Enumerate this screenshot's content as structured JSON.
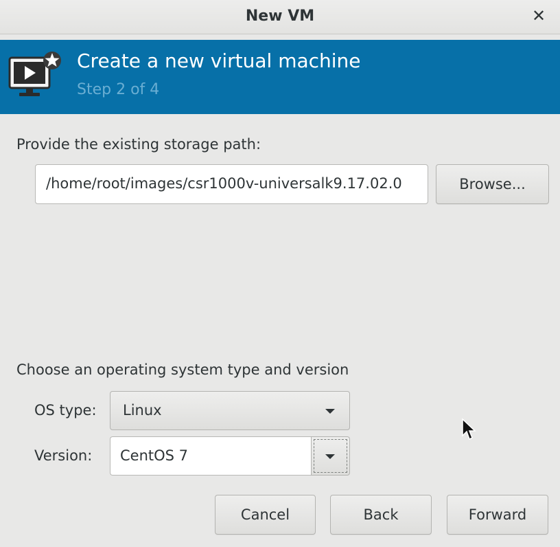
{
  "window": {
    "title": "New VM",
    "close_icon": "close-icon"
  },
  "banner": {
    "heading": "Create a new virtual machine",
    "step": "Step 2 of 4",
    "icon": "vm-screen-icon",
    "colors": {
      "background": "#0770a8",
      "step_text": "#6aaed3"
    }
  },
  "storage": {
    "label": "Provide the existing storage path:",
    "path_value": "/home/root/images/csr1000v-universalk9.17.02.0",
    "browse_label": "Browse..."
  },
  "os": {
    "heading": "Choose an operating system type and version",
    "type_label": "OS type:",
    "type_value": "Linux",
    "version_label": "Version:",
    "version_value": "CentOS 7"
  },
  "buttons": {
    "cancel": "Cancel",
    "back": "Back",
    "forward": "Forward"
  }
}
